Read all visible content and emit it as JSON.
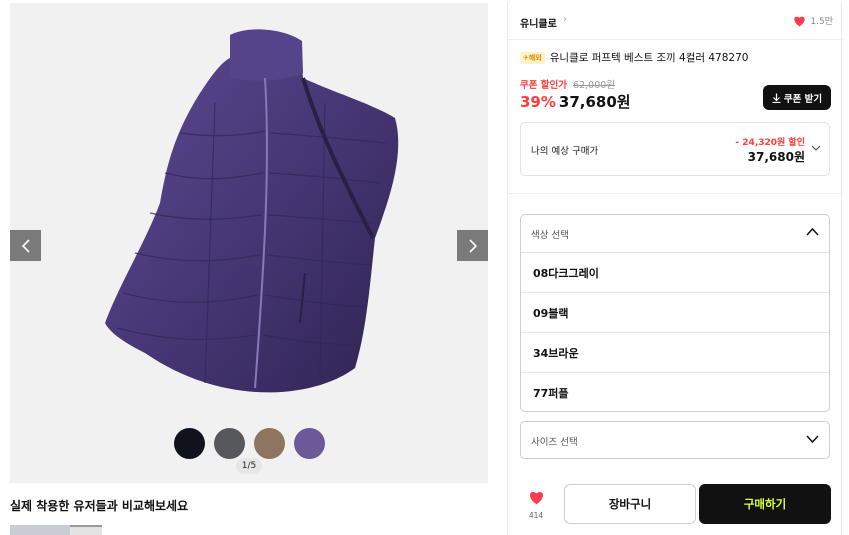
{
  "gallery": {
    "pager": "1/5",
    "swatches": [
      "#10131c",
      "#57585c",
      "#8e7560",
      "#6c5a98"
    ]
  },
  "compare": {
    "title": "실제 착용한 유저들과 비교해보세요"
  },
  "product": {
    "brand": "유니클로",
    "brand_chevron": "›",
    "like_count": "1.5만",
    "badge": "✈해외",
    "title": "유니클로 퍼프텍 베스트 조끼 4컬러 478270",
    "coupon_label": "쿠폰 할인가",
    "original_price": "62,000원",
    "discount_rate": "39%",
    "price": "37,680원",
    "coupon_button": "쿠폰 받기",
    "estimate": {
      "label": "나의 예상 구매가",
      "discount": "- 24,320원 할인",
      "price": "37,680원"
    }
  },
  "color_select": {
    "placeholder": "색상 선택",
    "options": [
      "08다크그레이",
      "09블랙",
      "34브라운",
      "77퍼플"
    ]
  },
  "size_select": {
    "placeholder": "사이즈 선택"
  },
  "actions": {
    "wish_count": "414",
    "cart_label": "장바구니",
    "buy_label": "구매하기"
  },
  "colors": {
    "accent_red": "#ff3b3b",
    "buy_text": "#d8ff3e",
    "vest_purple": "#4a3a7a"
  }
}
